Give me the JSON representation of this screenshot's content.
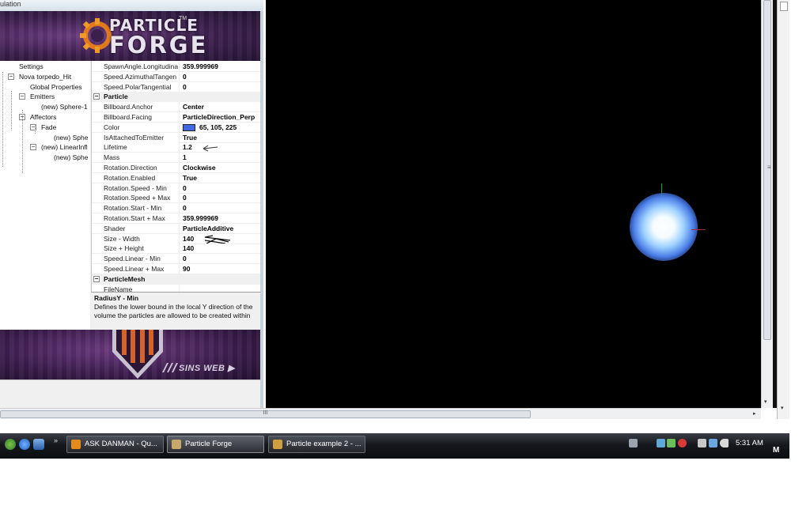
{
  "window": {
    "title_fragment": "ulation"
  },
  "banner": {
    "logo_line1": "PARTICLE",
    "logo_line2": "FORGE",
    "logo_tm": "TM",
    "footer_text": "SINS WEB ▶"
  },
  "tree": {
    "items": [
      {
        "label": "Settings",
        "depth": 0,
        "expander": ""
      },
      {
        "label": "Nova torpedo_Hit",
        "depth": 0,
        "expander": "−"
      },
      {
        "label": "Global Properties",
        "depth": 1,
        "expander": ""
      },
      {
        "label": "Emitters",
        "depth": 1,
        "expander": "−"
      },
      {
        "label": "(new) Sphere-1",
        "depth": 2,
        "expander": ""
      },
      {
        "label": "Affectors",
        "depth": 1,
        "expander": "−"
      },
      {
        "label": "Fade",
        "depth": 2,
        "expander": "−"
      },
      {
        "label": "(new) Sphe",
        "depth": 3,
        "expander": ""
      },
      {
        "label": "(new) LinearInfl",
        "depth": 2,
        "expander": "−"
      },
      {
        "label": "(new) Sphe",
        "depth": 3,
        "expander": ""
      }
    ],
    "scroll_thumb": "III",
    "scroll_right": "▸"
  },
  "properties": {
    "rows": [
      {
        "type": "prop",
        "name": "SpawnAngle.Longitudina",
        "value": "359.999969"
      },
      {
        "type": "prop",
        "name": "Speed.AzimuthalTangen",
        "value": "0"
      },
      {
        "type": "prop",
        "name": "Speed.PolarTangential",
        "value": "0"
      },
      {
        "type": "cat",
        "name": "Particle",
        "expander": "−"
      },
      {
        "type": "prop",
        "name": "Billboard.Anchor",
        "value": "Center"
      },
      {
        "type": "prop",
        "name": "Billboard.Facing",
        "value": "ParticleDirection_Perp"
      },
      {
        "type": "prop",
        "name": "Color",
        "value": "65, 105, 225",
        "swatch": "#4169e1"
      },
      {
        "type": "prop",
        "name": "IsAttachedToEmitter",
        "value": "True"
      },
      {
        "type": "prop",
        "name": "Lifetime",
        "value": "1.2",
        "mark": "arrow"
      },
      {
        "type": "prop",
        "name": "Mass",
        "value": "1"
      },
      {
        "type": "prop",
        "name": "Rotation.Direction",
        "value": "Clockwise"
      },
      {
        "type": "prop",
        "name": "Rotation.Enabled",
        "value": "True"
      },
      {
        "type": "prop",
        "name": "Rotation.Speed - Min",
        "value": "0"
      },
      {
        "type": "prop",
        "name": "Rotation.Speed + Max",
        "value": "0"
      },
      {
        "type": "prop",
        "name": "Rotation.Start - Min",
        "value": "0"
      },
      {
        "type": "prop",
        "name": "Rotation.Start + Max",
        "value": "359.999969"
      },
      {
        "type": "prop",
        "name": "Shader",
        "value": "ParticleAdditive"
      },
      {
        "type": "prop",
        "name": "Size - Width",
        "value": "140",
        "mark": "scribble"
      },
      {
        "type": "prop",
        "name": "Size + Height",
        "value": "140"
      },
      {
        "type": "prop",
        "name": "Speed.Linear - Min",
        "value": "0"
      },
      {
        "type": "prop",
        "name": "Speed.Linear + Max",
        "value": "90"
      },
      {
        "type": "cat",
        "name": "ParticleMesh",
        "expander": "−"
      },
      {
        "type": "prop",
        "name": "FileName",
        "value": ""
      }
    ],
    "description": {
      "title": "RadiusY - Min",
      "text": "Defines the lower bound in the local Y direction of the volume the particles are allowed to be created within"
    }
  },
  "viewport": {
    "background": "#000000",
    "particle_color": "#4b7fe8"
  },
  "scrollbars": {
    "h_thumb": "III",
    "h_right": "▸",
    "v_down": "▾",
    "v_grip": "≡"
  },
  "taskbar": {
    "quicklaunch_more": "»",
    "buttons": [
      {
        "label": "ASK DANMAN - Qu...",
        "icon_color": "#e58a1f",
        "active": false
      },
      {
        "label": "Particle Forge",
        "icon_color": "#c9a66b",
        "active": true
      },
      {
        "label": "Particle example 2 - ...",
        "icon_color": "#d0a040",
        "active": false
      }
    ],
    "clock": "5:31 AM",
    "edge_label": "M"
  }
}
